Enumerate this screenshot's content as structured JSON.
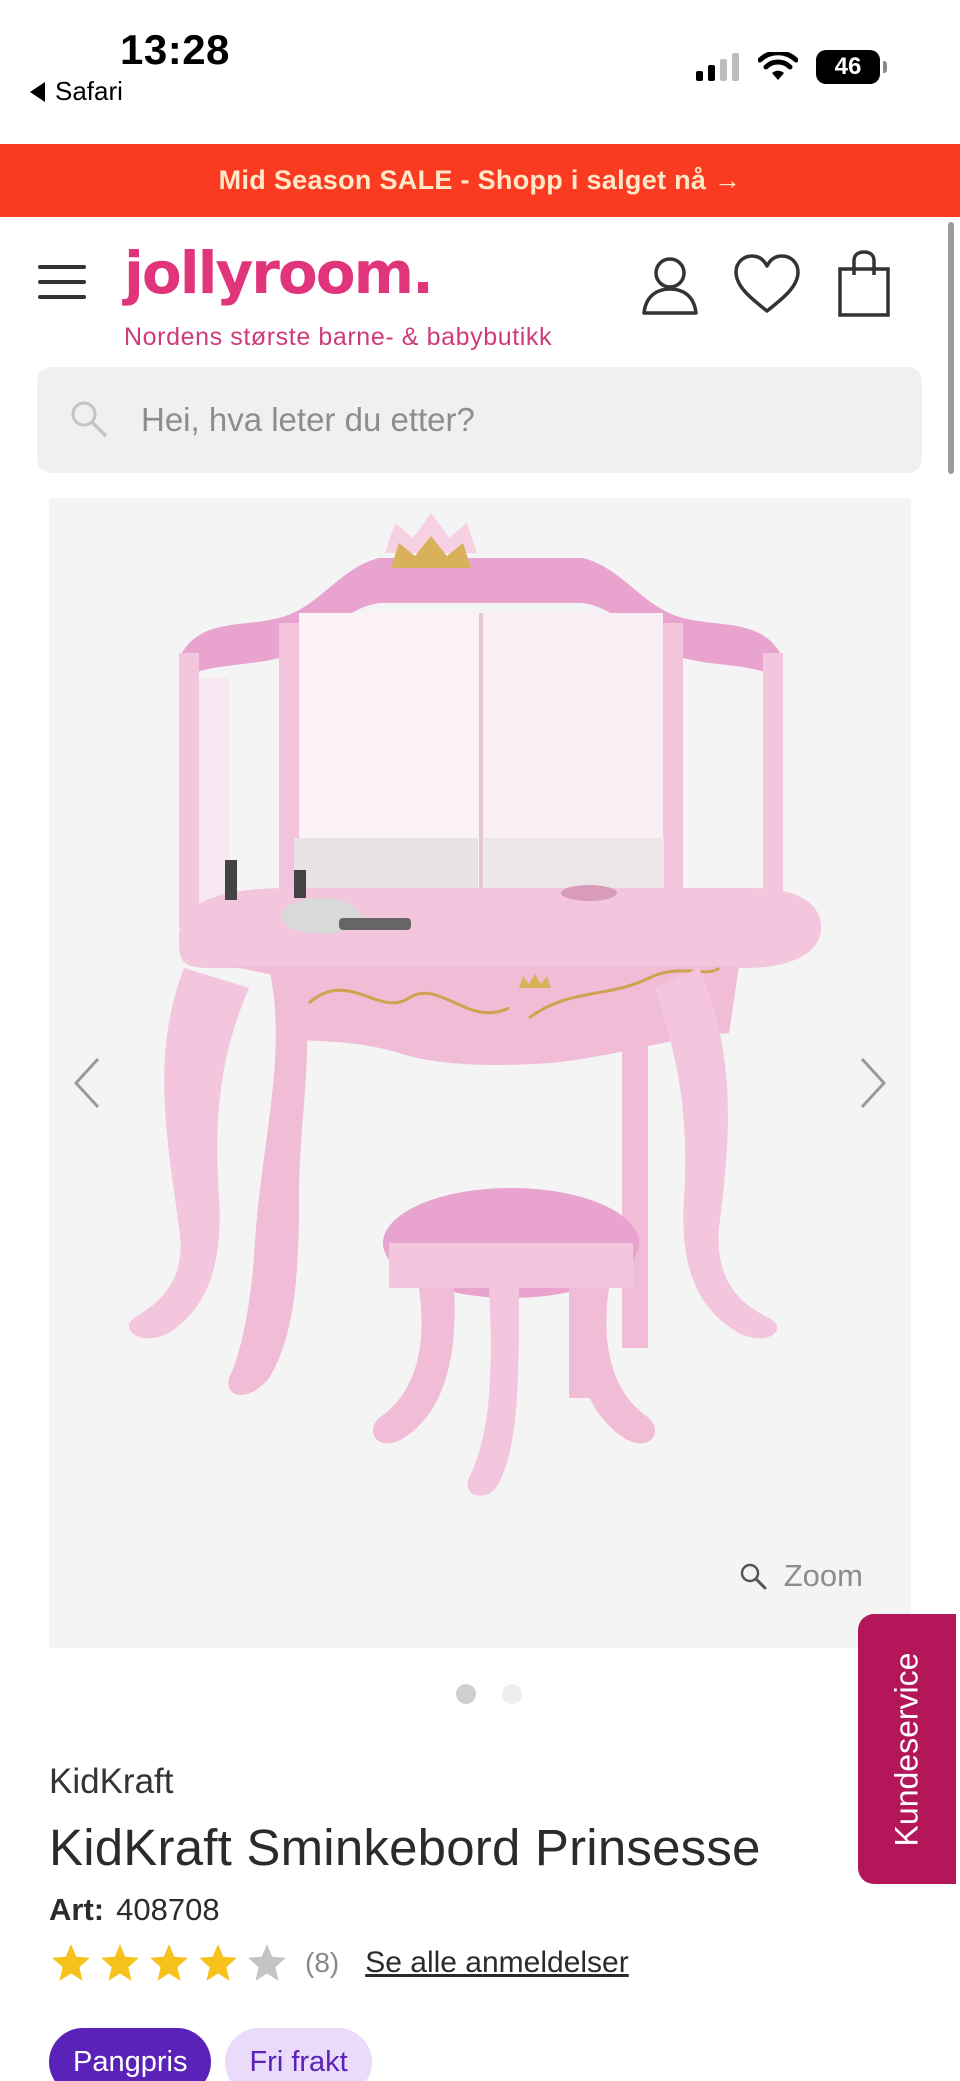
{
  "status_bar": {
    "time": "13:28",
    "back_label": "Safari",
    "battery": "46"
  },
  "promo": {
    "text": "Mid Season SALE - Shopp i salget nå →"
  },
  "header": {
    "logo": "jollyroom.",
    "tagline": "Nordens største barne- & babybutikk"
  },
  "search": {
    "placeholder": "Hei, hva leter du etter?"
  },
  "gallery": {
    "zoom_label": "Zoom",
    "image_count": 2,
    "active_index": 0
  },
  "customer_service": {
    "label": "Kundeservice"
  },
  "product": {
    "brand": "KidKraft",
    "name": "KidKraft Sminkebord Prinsesse",
    "art_label": "Art:",
    "art_number": "408708",
    "rating": 4,
    "rating_max": 5,
    "review_count": "(8)",
    "reviews_link": "Se alle anmeldelser",
    "badges": [
      "Pangpris",
      "Fri frakt"
    ]
  },
  "colors": {
    "promo_bg": "#fb3a22",
    "brand_pink": "#e0357a",
    "customer_service": "#b3175a",
    "badge_purple": "#5a22b8",
    "star": "#f8c21c"
  }
}
